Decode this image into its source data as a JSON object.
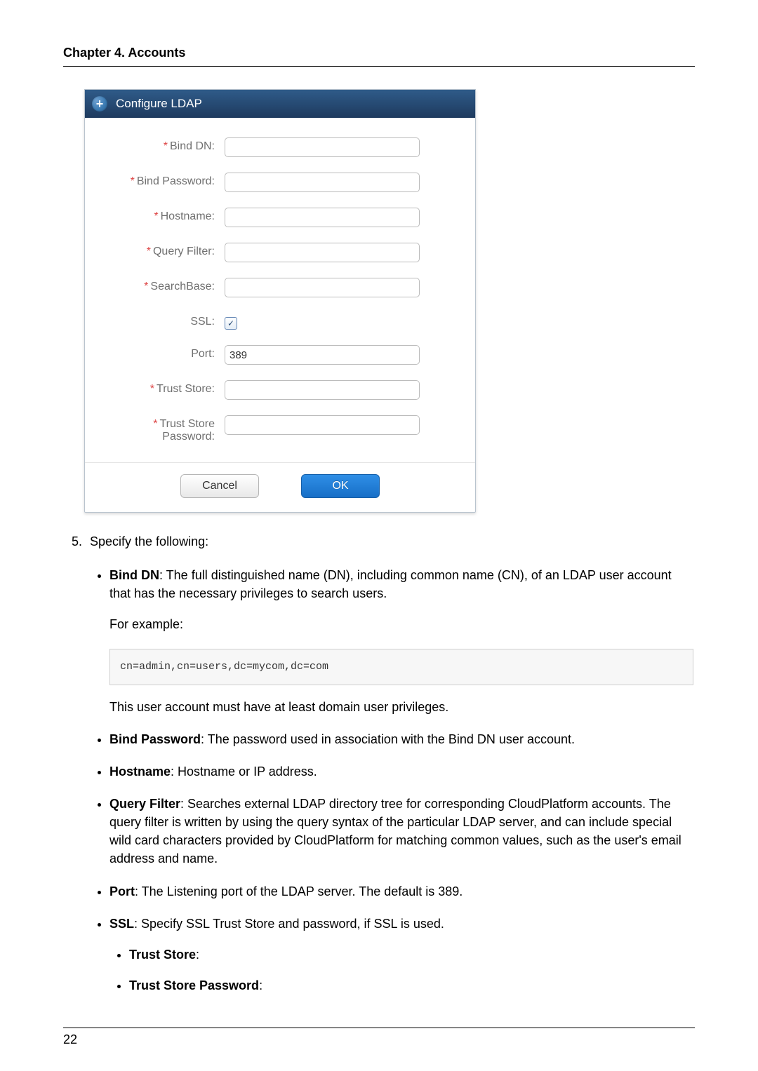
{
  "header": {
    "chapter_title": "Chapter 4. Accounts"
  },
  "dialog": {
    "title": "Configure LDAP",
    "fields": {
      "bind_dn": {
        "label": "Bind DN:",
        "required": true,
        "value": ""
      },
      "bind_password": {
        "label": "Bind Password:",
        "required": true,
        "value": ""
      },
      "hostname": {
        "label": "Hostname:",
        "required": true,
        "value": ""
      },
      "query_filter": {
        "label": "Query Filter:",
        "required": true,
        "value": ""
      },
      "search_base": {
        "label": "SearchBase:",
        "required": true,
        "value": ""
      },
      "ssl": {
        "label": "SSL:",
        "required": false,
        "checked": true
      },
      "port": {
        "label": "Port:",
        "required": false,
        "value": "389"
      },
      "trust_store": {
        "label": "Trust Store:",
        "required": true,
        "value": ""
      },
      "trust_store_password": {
        "label": "Trust Store\nPassword:",
        "required": true,
        "value": ""
      }
    },
    "buttons": {
      "cancel": "Cancel",
      "ok": "OK"
    }
  },
  "step5": {
    "number": "5.",
    "intro": "Specify the following:",
    "items": {
      "bind_dn": {
        "term": "Bind DN",
        "desc": ": The full distinguished name (DN), including common name (CN), of an LDAP user account that has the necessary privileges to search users.",
        "example_label": "For example:",
        "example_code": "cn=admin,cn=users,dc=mycom,dc=com",
        "note": "This user account must have at least domain user privileges."
      },
      "bind_password": {
        "term": "Bind Password",
        "desc": ": The password used in association with the Bind DN user account."
      },
      "hostname": {
        "term": "Hostname",
        "desc": ": Hostname or IP address."
      },
      "query_filter": {
        "term": "Query Filter",
        "desc": ": Searches external LDAP directory tree for corresponding CloudPlatform accounts. The query filter is written by using the query syntax of the particular LDAP server, and can include special wild card characters provided by CloudPlatform for matching common values, such as the user's email address and name."
      },
      "port": {
        "term": "Port",
        "desc": ": The Listening port of the LDAP server. The default is 389."
      },
      "ssl": {
        "term": "SSL",
        "desc": ": Specify SSL Trust Store and password, if SSL is used.",
        "sub": {
          "trust_store": {
            "term": "Trust Store",
            "desc": ":"
          },
          "trust_store_password": {
            "term": "Trust Store Password",
            "desc": ":"
          }
        }
      }
    }
  },
  "footer": {
    "page_number": "22"
  }
}
